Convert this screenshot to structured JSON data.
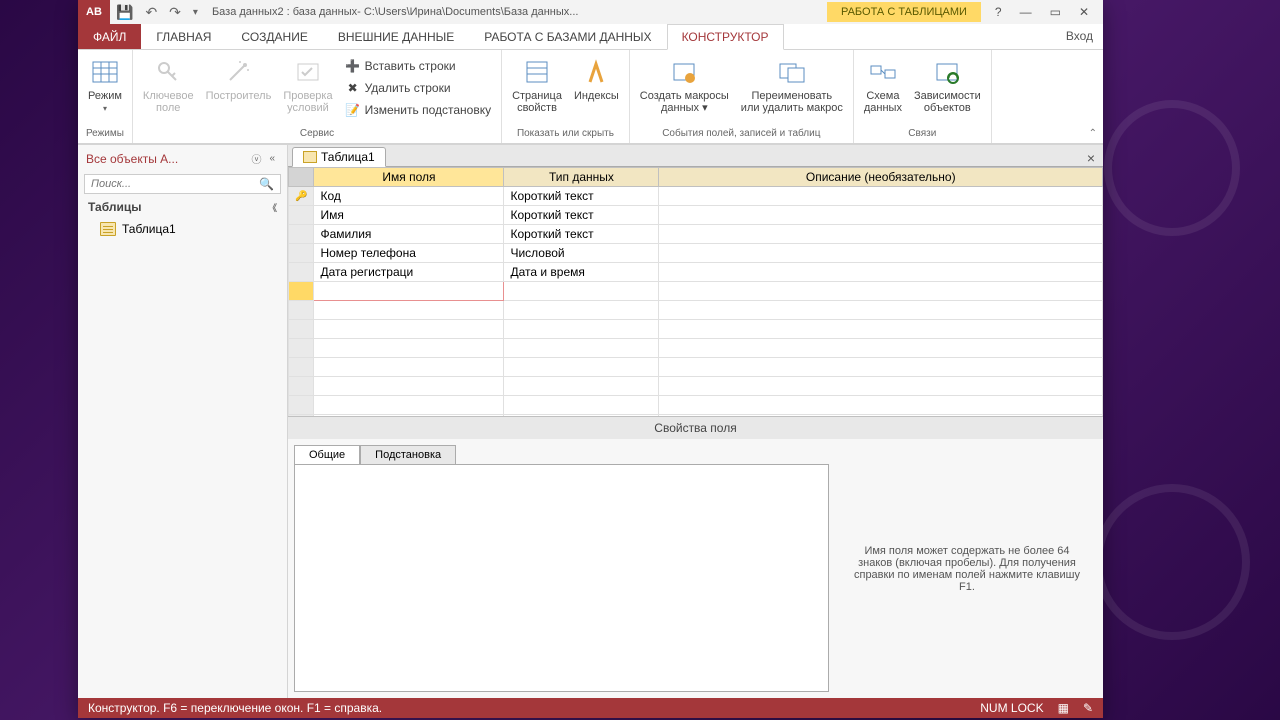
{
  "titlebar": {
    "app_abbrev": "AB",
    "title": "База данных2 : база данных- C:\\Users\\Ирина\\Documents\\База данных...",
    "context_label": "РАБОТА С ТАБЛИЦАМИ",
    "login": "Вход"
  },
  "tabs": {
    "file": "ФАЙЛ",
    "home": "ГЛАВНАЯ",
    "create": "СОЗДАНИЕ",
    "external": "ВНЕШНИЕ ДАННЫЕ",
    "dbtools": "РАБОТА С БАЗАМИ ДАННЫХ",
    "designer": "КОНСТРУКТОР"
  },
  "ribbon": {
    "views": {
      "view": "Режим",
      "group": "Режимы"
    },
    "tools": {
      "pk": "Ключевое\nполе",
      "builder": "Построитель",
      "test": "Проверка\nусловий",
      "insert": "Вставить строки",
      "delete": "Удалить строки",
      "modify": "Изменить подстановку",
      "group": "Сервис"
    },
    "showhide": {
      "propsheet": "Страница\nсвойств",
      "indexes": "Индексы",
      "group": "Показать или скрыть"
    },
    "events": {
      "create_macro": "Создать макросы\nданных ▾",
      "rename_macro": "Переименовать\nили удалить макрос",
      "group": "События полей, записей и таблиц"
    },
    "rel": {
      "rel_diagram": "Схема\nданных",
      "deps": "Зависимости\nобъектов",
      "group": "Связи"
    }
  },
  "nav": {
    "header": "Все объекты A...",
    "search_placeholder": "Поиск...",
    "section": "Таблицы",
    "item1": "Таблица1"
  },
  "doc": {
    "tab": "Таблица1"
  },
  "grid": {
    "col_name": "Имя поля",
    "col_type": "Тип данных",
    "col_desc": "Описание (необязательно)",
    "rows": [
      {
        "name": "Код",
        "type": "Короткий текст",
        "desc": "",
        "pk": true
      },
      {
        "name": "Имя",
        "type": "Короткий текст",
        "desc": ""
      },
      {
        "name": "Фамилия",
        "type": "Короткий текст",
        "desc": ""
      },
      {
        "name": "Номер телефона",
        "type": "Числовой",
        "desc": ""
      },
      {
        "name": "Дата регистраци",
        "type": "Дата и время",
        "desc": ""
      }
    ]
  },
  "props": {
    "title": "Свойства поля",
    "tab_general": "Общие",
    "tab_lookup": "Подстановка",
    "help": "Имя поля может содержать не более 64 знаков (включая пробелы). Для получения справки по именам полей нажмите клавишу F1."
  },
  "status": {
    "left": "Конструктор.  F6 = переключение окон.  F1 = справка.",
    "numlock": "NUM LOCK"
  }
}
